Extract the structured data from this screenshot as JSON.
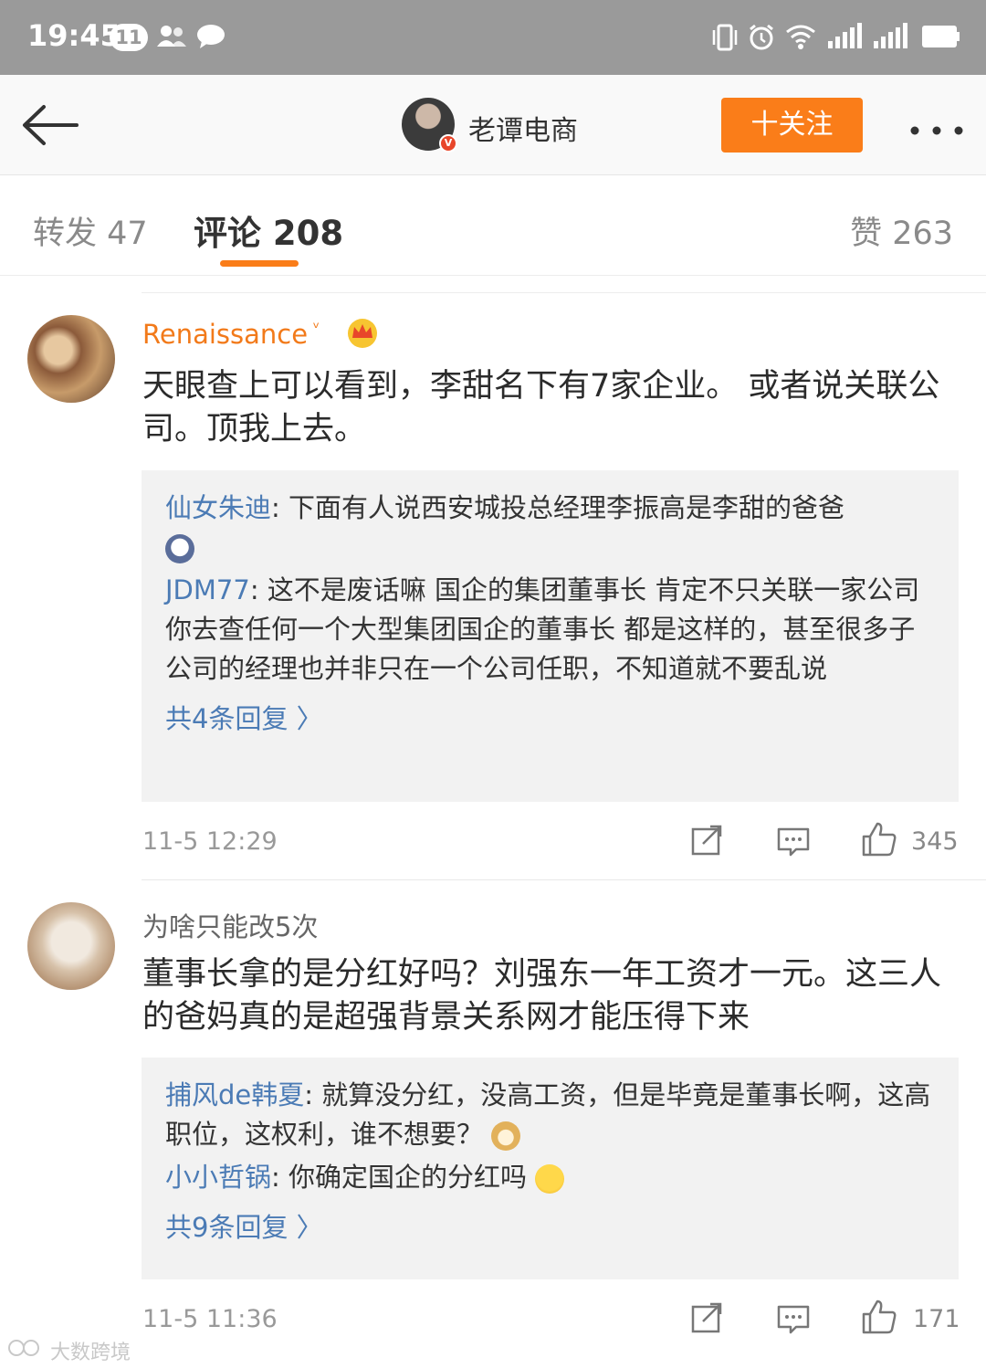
{
  "status_bar": {
    "time": "19:45",
    "notification_count": "11"
  },
  "header": {
    "account_name": "老谭电商",
    "follow_label": "十关注",
    "verified_badge": "V"
  },
  "tabs": {
    "repost": "转发 47",
    "comments": "评论 208",
    "likes": "赞 263"
  },
  "comments": [
    {
      "user": "Renaissance",
      "text": "天眼查上可以看到，李甜名下有7家企业。 或者说关联公司。顶我上去。",
      "replies": [
        {
          "user": "仙女朱迪",
          "text": ": 下面有人说西安城投总经理李振高是李甜的爸爸"
        },
        {
          "user": "JDM77",
          "text": ": 这不是废话嘛 国企的集团董事长 肯定不只关联一家公司 你去查任何一个大型集团国企的董事长 都是这样的，甚至很多子公司的经理也并非只在一个公司任职，不知道就不要乱说"
        }
      ],
      "more_replies": "共4条回复 〉",
      "time": "11-5 12:29",
      "likes": "345"
    },
    {
      "user": "为啥只能改5次",
      "text": "董事长拿的是分红好吗？刘强东一年工资才一元。这三人的爸妈真的是超强背景关系网才能压得下来",
      "replies": [
        {
          "user": "捕风de韩夏",
          "text": ": 就算没分红，没高工资，但是毕竟是董事长啊，这高职位，这权利，谁不想要？"
        },
        {
          "user": "小小哲锅",
          "text": ": 你确定国企的分红吗"
        }
      ],
      "more_replies": "共9条回复 〉",
      "time": "11-5 11:36",
      "likes": "171"
    }
  ],
  "watermark": "大数跨境",
  "colors": {
    "accent": "#fa7d19",
    "link_blue": "#4b7bb5",
    "username_orange": "#f27a1a",
    "status_bar": "#9a9a9a"
  }
}
